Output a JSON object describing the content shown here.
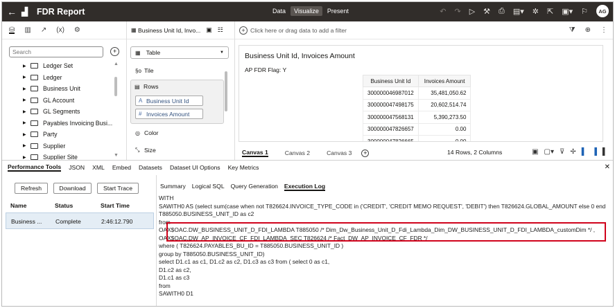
{
  "app": {
    "title": "FDR Report",
    "modes": [
      "Data",
      "Visualize",
      "Present"
    ],
    "active_mode": "Visualize",
    "user_initials": "AG"
  },
  "data_panel": {
    "tabs": [
      "data-icon",
      "viz-icon",
      "analytics-icon",
      "calc-icon",
      "settings-icon"
    ],
    "search_placeholder": "Search",
    "tree_items": [
      "Ledger Set",
      "Ledger",
      "Business Unit",
      "GL Account",
      "GL Segments",
      "Payables Invoicing Busi...",
      "Party",
      "Supplier",
      "Supplier Site"
    ]
  },
  "grammar_panel": {
    "header": "Business Unit Id, Invo...",
    "viz_type": "Table",
    "tile_label": "Tile",
    "rows_label": "Rows",
    "rows_items": [
      "Business Unit Id",
      "Invoices Amount"
    ],
    "color_label": "Color",
    "size_label": "Size"
  },
  "filter_bar": {
    "placeholder": "Click here or drag data to add a filter"
  },
  "visualization": {
    "title": "Business Unit Id, Invoices Amount",
    "subtitle": "AP FDR Flag: Y",
    "columns": [
      "Business Unit Id",
      "Invoices Amount"
    ],
    "rows": [
      [
        "300000046987012",
        "35,481,050.62"
      ],
      [
        "300000047498175",
        "20,602,514.74"
      ],
      [
        "300000047568131",
        "5,390,273.50"
      ],
      [
        "300000047826657",
        "0.00"
      ],
      [
        "300000047826665",
        "0.00"
      ]
    ]
  },
  "canvas_tabs": {
    "tabs": [
      "Canvas 1",
      "Canvas 2",
      "Canvas 3"
    ],
    "active": "Canvas 1",
    "info": "14 Rows, 2 Columns"
  },
  "performance_tools": {
    "tabs": [
      "Performance Tools",
      "JSON",
      "XML",
      "Embed",
      "Datasets",
      "Dataset UI Options",
      "Key Metrics"
    ],
    "buttons": {
      "refresh": "Refresh",
      "download": "Download",
      "start_trace": "Start Trace"
    },
    "columns": {
      "name": "Name",
      "status": "Status",
      "start_time": "Start Time"
    },
    "session": {
      "name": "Business ...",
      "status": "Complete",
      "start_time": "2:46:12.790"
    },
    "sub_tabs": [
      "Summary",
      "Logical SQL",
      "Query Generation",
      "Execution Log"
    ],
    "active_sub_tab": "Execution Log",
    "log_lines": [
      "WITH",
      "SAWITH0 AS (select sum(case  when not T826624.INVOICE_TYPE_CODE in ('CREDIT', 'CREDIT MEMO REQUEST', 'DEBIT') then T826624.GLOBAL_AMOUNT else 0 end",
      "     T885050.BUSINESS_UNIT_ID as c2",
      "from",
      "     OAX$OAC.DW_BUSINESS_UNIT_D_FDI_LAMBDA T885050 /* Dim_Dw_Business_Unit_D_Fdi_Lambda_Dim_DW_BUSINESS_UNIT_D_FDI_LAMBDA_customDim */ ,",
      "     OAX$OAC.DW_AP_INVOICE_CF_FDI_LAMBDA_SEC T826624 /* Fact_DW_AP_INVOICE_CF_FDR */",
      "where  ( T826624.PAYABLES_BU_ID = T885050.BUSINESS_UNIT_ID )",
      "group by T885050.BUSINESS_UNIT_ID)",
      "select D1.c1 as c1, D1.c2 as c2, D1.c3 as c3 from ( select 0 as c1,",
      "     D1.c2 as c2,",
      "     D1.c1 as c3",
      "from",
      "     SAWITH0 D1"
    ]
  }
}
